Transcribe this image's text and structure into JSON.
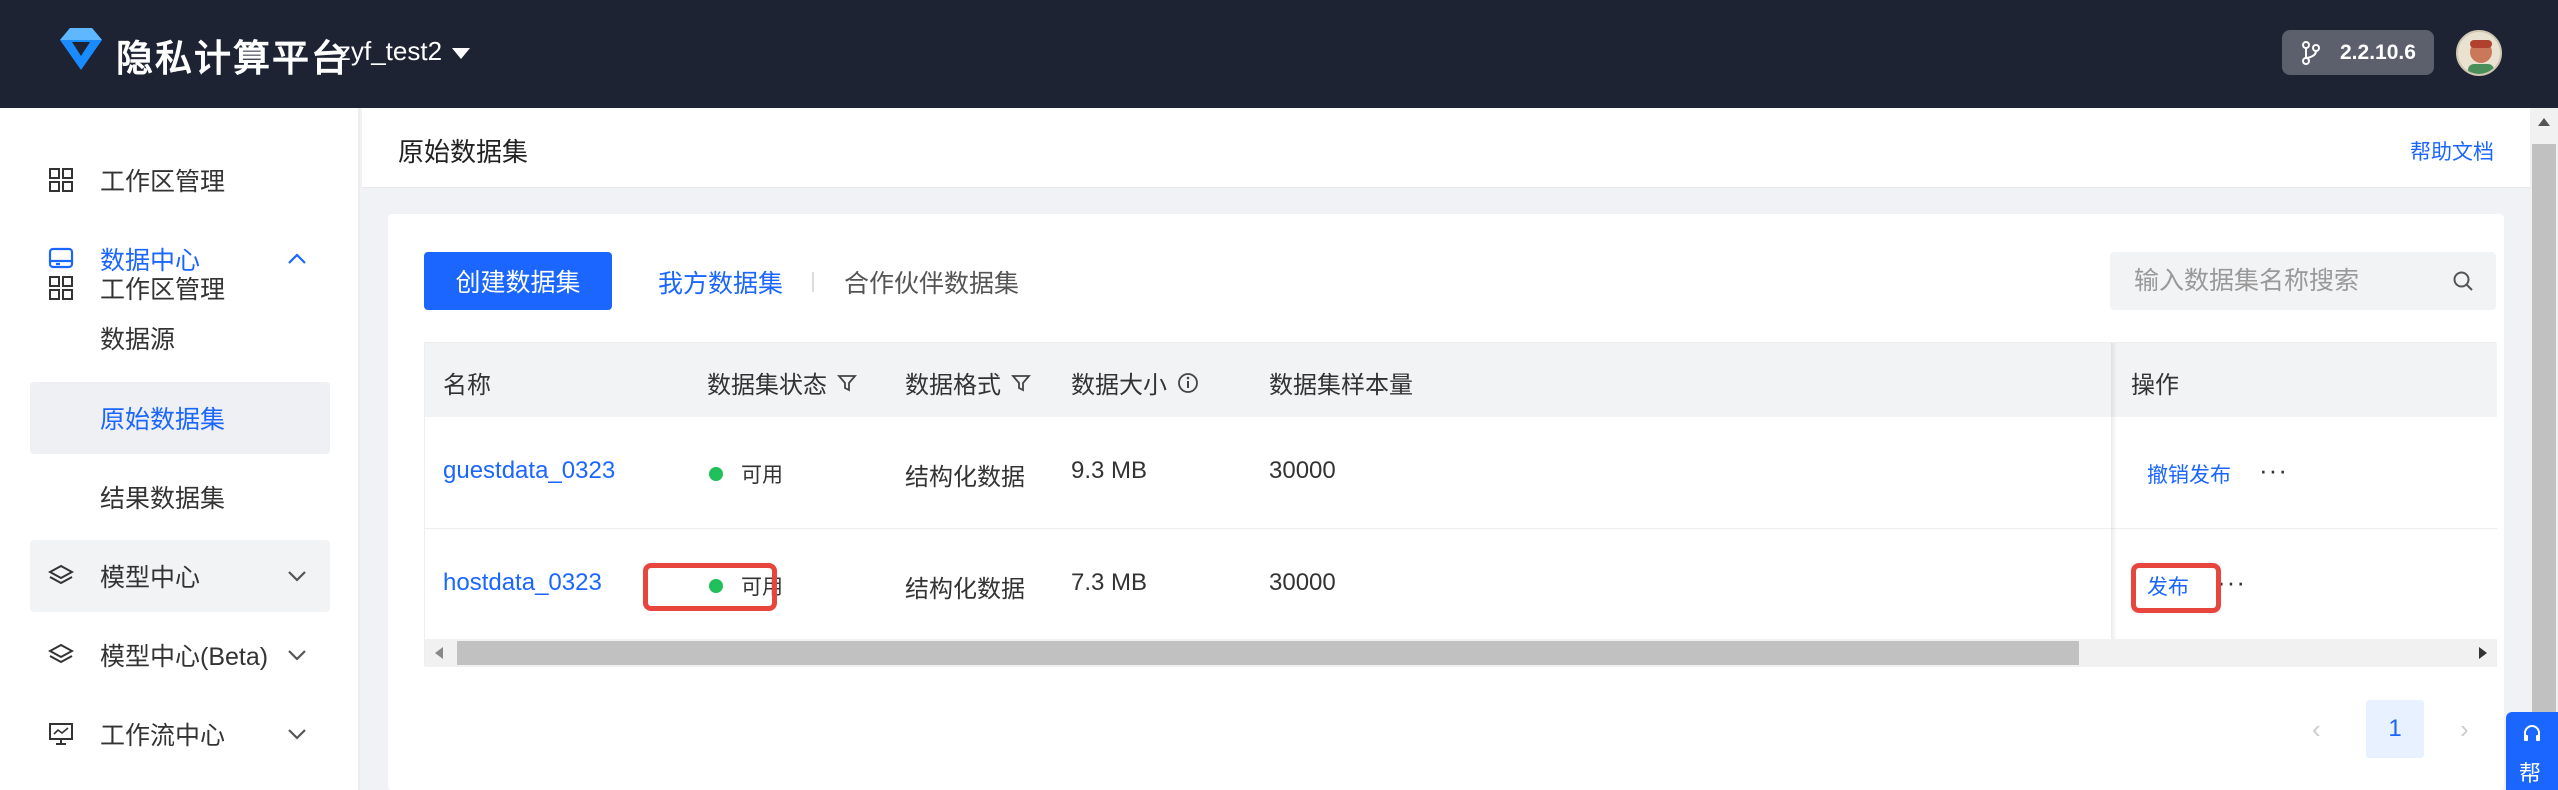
{
  "header": {
    "brand": "隐私计算平台",
    "workspace": "zyf_test2",
    "version": "2.2.10.6"
  },
  "sidebar": {
    "items": [
      {
        "label": "工作区管理",
        "icon": "grid-icon"
      },
      {
        "label": "数据中心",
        "icon": "database-icon",
        "expanded": true
      },
      {
        "label": "数据源"
      },
      {
        "label": "原始数据集",
        "selected": true
      },
      {
        "label": "结果数据集"
      },
      {
        "label": "模型中心",
        "icon": "layers-icon"
      },
      {
        "label": "模型中心(Beta)",
        "icon": "layers-icon"
      },
      {
        "label": "工作流中心",
        "icon": "monitor-icon"
      }
    ]
  },
  "page": {
    "title": "原始数据集",
    "help_link": "帮助文档"
  },
  "toolbar": {
    "create_label": "创建数据集",
    "tabs": [
      {
        "label": "我方数据集",
        "active": true
      },
      {
        "label": "合作伙伴数据集",
        "active": false
      }
    ],
    "search_placeholder": "输入数据集名称搜索"
  },
  "table": {
    "columns": [
      "名称",
      "数据集状态",
      "数据格式",
      "数据大小",
      "数据集样本量",
      "操作"
    ],
    "rows": [
      {
        "name": "guestdata_0323",
        "status": "可用",
        "format": "结构化数据",
        "size": "9.3 MB",
        "samples": "30000",
        "action": "撤销发布",
        "more": "···"
      },
      {
        "name": "hostdata_0323",
        "status": "可用",
        "format": "结构化数据",
        "size": "7.3 MB",
        "samples": "30000",
        "action": "发布",
        "more": "···"
      }
    ]
  },
  "pagination": {
    "prev": "‹",
    "current": "1",
    "next": "›"
  },
  "help_float": {
    "label": "帮"
  },
  "colors": {
    "primary": "#1a66ff",
    "topbar": "#1d2333",
    "status_ok": "#1fbf5a",
    "highlight": "#e8453c"
  }
}
